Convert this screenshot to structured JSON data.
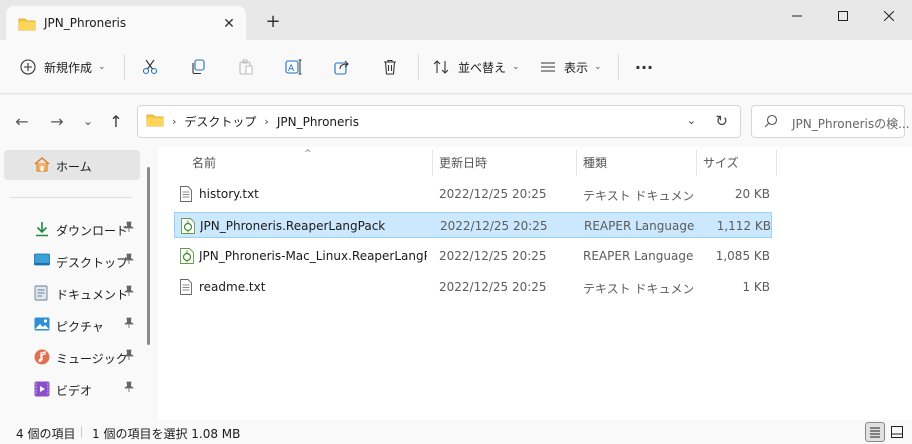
{
  "tab": {
    "title": "JPN_Phroneris",
    "close": "✕",
    "new_tab": "+"
  },
  "window_controls": {
    "minimize": "—",
    "maximize": "☐",
    "close": "✕"
  },
  "toolbar": {
    "new_label": "新規作成",
    "sort_label": "並べ替え",
    "view_label": "表示",
    "more_label": "···",
    "chevron": "⌄"
  },
  "nav": {
    "back": "←",
    "forward": "→",
    "recent": "⌄",
    "up": "↑"
  },
  "address": {
    "crumbs": [
      "デスクトップ",
      "JPN_Phroneris"
    ],
    "separator": "›",
    "dropdown": "⌄",
    "refresh": "↻"
  },
  "search": {
    "placeholder": "JPN_Phronerisの検..."
  },
  "sidebar": {
    "home": "ホーム",
    "items": [
      {
        "label": "ダウンロード",
        "icon": "download-icon"
      },
      {
        "label": "デスクトップ",
        "icon": "desktop-icon"
      },
      {
        "label": "ドキュメント",
        "icon": "document-icon"
      },
      {
        "label": "ピクチャ",
        "icon": "picture-icon"
      },
      {
        "label": "ミュージック",
        "icon": "music-icon"
      },
      {
        "label": "ビデオ",
        "icon": "video-icon"
      }
    ],
    "pin": "📌"
  },
  "columns": {
    "name": "名前",
    "date": "更新日時",
    "type": "種類",
    "size": "サイズ",
    "sort_indicator": "^"
  },
  "files": [
    {
      "name": "history.txt",
      "date": "2022/12/25 20:25",
      "type": "テキスト ドキュメント",
      "size": "20 KB",
      "icon": "text-file-icon",
      "selected": false
    },
    {
      "name": "JPN_Phroneris.ReaperLangPack",
      "date": "2022/12/25 20:25",
      "type": "REAPER Language...",
      "size": "1,112 KB",
      "icon": "reaper-langpack-icon",
      "selected": true
    },
    {
      "name": "JPN_Phroneris-Mac_Linux.ReaperLangPa...",
      "date": "2022/12/25 20:25",
      "type": "REAPER Language...",
      "size": "1,085 KB",
      "icon": "reaper-langpack-icon",
      "selected": false
    },
    {
      "name": "readme.txt",
      "date": "2022/12/25 20:25",
      "type": "テキスト ドキュメント",
      "size": "1 KB",
      "icon": "text-file-icon",
      "selected": false
    }
  ],
  "status": {
    "count": "4 個の項目",
    "selection": "1 個の項目を選択  1.08 MB"
  },
  "colors": {
    "selection_bg": "#cce8ff",
    "selection_border": "#99d1ff",
    "folder": "#f8c840"
  }
}
